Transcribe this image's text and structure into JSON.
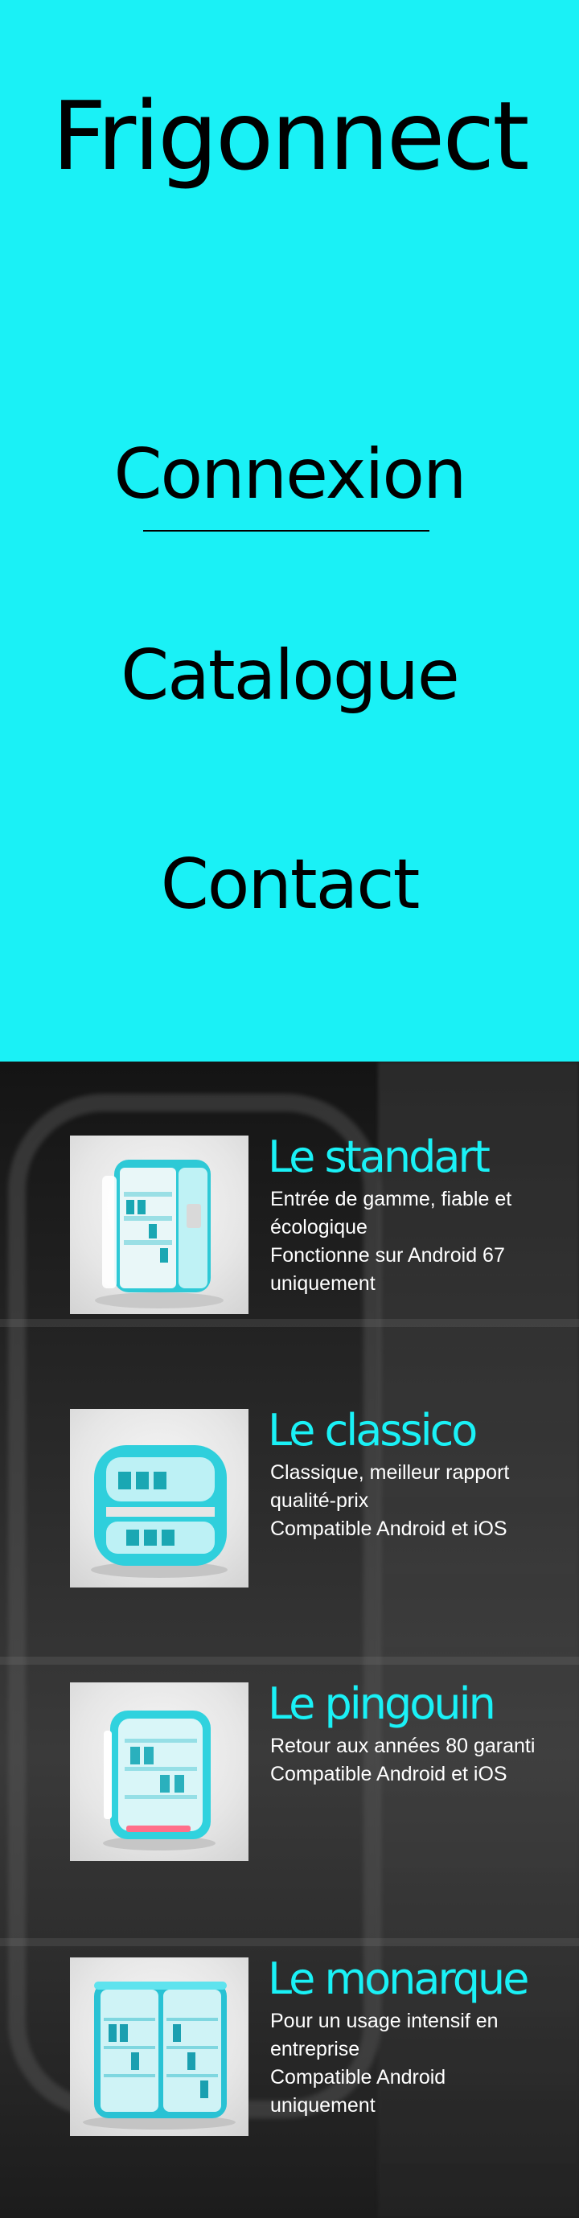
{
  "brand": {
    "name": "Frigonnect"
  },
  "nav": {
    "items": [
      {
        "label": "Connexion",
        "active": true
      },
      {
        "label": "Catalogue",
        "active": false
      },
      {
        "label": "Contact",
        "active": false
      }
    ]
  },
  "colors": {
    "accent": "#1af1f6",
    "text_dark": "#000000",
    "text_light": "#ffffff"
  },
  "catalog": {
    "products": [
      {
        "name": "Le standart",
        "desc_line1": "Entrée de gamme, fiable et écologique",
        "desc_line2": "Fonctionne sur Android 67 uniquement",
        "image_icon": "fridge-standart-image"
      },
      {
        "name": "Le classico",
        "desc_line1": "Classique, meilleur rapport qualité-prix",
        "desc_line2": "Compatible Android et iOS",
        "image_icon": "fridge-classico-image"
      },
      {
        "name": "Le pingouin",
        "desc_line1": "Retour aux années 80 garanti",
        "desc_line2": "Compatible Android et iOS",
        "image_icon": "fridge-pingouin-image"
      },
      {
        "name": "Le monarque",
        "desc_line1": "Pour un usage intensif en entreprise",
        "desc_line2": "Compatible Android uniquement",
        "image_icon": "fridge-monarque-image"
      }
    ]
  }
}
